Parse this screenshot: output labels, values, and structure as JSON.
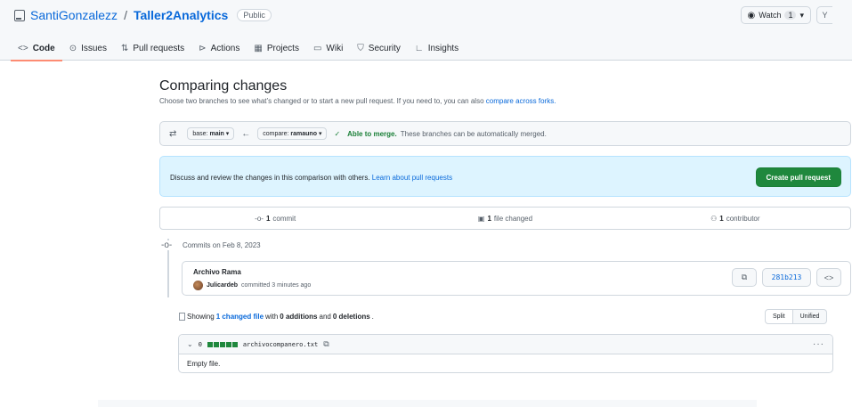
{
  "repo": {
    "owner": "SantiGonzalezz",
    "separator": "/",
    "name": "Taller2Analytics",
    "visibility": "Public",
    "watch_label": "Watch",
    "watch_count": "1",
    "watch_caret": "▾"
  },
  "nav": {
    "tabs": [
      {
        "label": "Code",
        "icon": "code-icon",
        "glyph": "<>",
        "selected": true
      },
      {
        "label": "Issues",
        "icon": "issue-icon",
        "glyph": "⊙"
      },
      {
        "label": "Pull requests",
        "icon": "pull-request-icon",
        "glyph": "⇅"
      },
      {
        "label": "Actions",
        "icon": "play-icon",
        "glyph": "⊳"
      },
      {
        "label": "Projects",
        "icon": "table-icon",
        "glyph": "▦"
      },
      {
        "label": "Wiki",
        "icon": "book-icon",
        "glyph": "▭"
      },
      {
        "label": "Security",
        "icon": "shield-icon",
        "glyph": "⛉"
      },
      {
        "label": "Insights",
        "icon": "graph-icon",
        "glyph": "∟"
      }
    ]
  },
  "compare": {
    "title": "Comparing changes",
    "subtitle": "Choose two branches to see what’s changed or to start a new pull request. If you need to, you can also ",
    "subtitle_link": "compare across forks.",
    "base_prefix": "base:",
    "base_branch": "main",
    "compare_prefix": "compare:",
    "compare_branch": "ramauno",
    "merge_status": "Able to merge.",
    "merge_message": "These branches can be automatically merged."
  },
  "flash": {
    "text": "Discuss and review the changes in this comparison with others. ",
    "link": "Learn about pull requests",
    "button": "Create pull request"
  },
  "stats": {
    "commits_count": "1",
    "commits_label": "commit",
    "files_count": "1",
    "files_label": "file changed",
    "contributors_count": "1",
    "contributors_label": "contributor"
  },
  "timeline": {
    "date_label": "Commits on Feb 8, 2023",
    "commit": {
      "title": "Archivo Rama",
      "author": "Julicardeb",
      "meta": "committed 3 minutes ago",
      "sha": "281b213"
    }
  },
  "diff": {
    "showing": "Showing ",
    "changed_link": "1 changed file",
    "with": " with ",
    "additions": "0 additions",
    "and": " and ",
    "deletions": "0 deletions",
    "period": ".",
    "split_label": "Split",
    "unified_label": "Unified",
    "file": {
      "changes": "0",
      "name": "archivocompanero.txt",
      "body": "Empty file."
    }
  },
  "colors": {
    "primary_button": "#1f883d",
    "link": "#0969da",
    "merge_ok": "#1a7f37",
    "flash_bg": "#ddf4ff",
    "selected_tab_underline": "#fd8c73"
  }
}
